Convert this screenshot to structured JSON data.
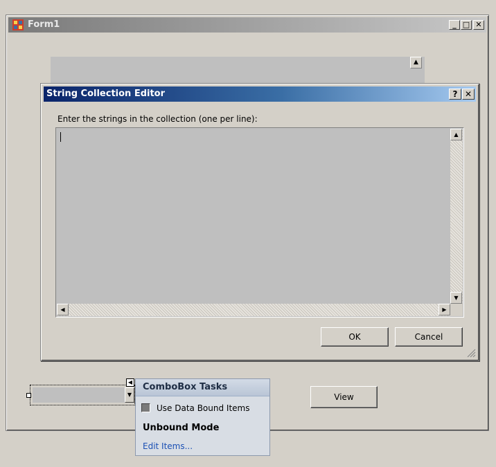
{
  "window": {
    "title": "Form1",
    "minimize_label": "_",
    "maximize_label": "□",
    "close_label": "✕"
  },
  "dialog": {
    "title": "String Collection Editor",
    "help_label": "?",
    "close_label": "✕",
    "instruction": "Enter the strings in the collection (one per line):",
    "text_value": "",
    "ok_label": "OK",
    "cancel_label": "Cancel"
  },
  "combobox": {
    "value": "",
    "smart_tag_icon": "left-arrow-icon",
    "tasks_title": "ComboBox Tasks",
    "use_data_bound_label": "Use Data Bound Items",
    "use_data_bound_checked": false,
    "mode_label": "Unbound Mode",
    "edit_items_label": "Edit Items..."
  },
  "view_button_label": "View",
  "colors": {
    "dialog_title_start": "#0a246a",
    "dialog_title_end": "#a6caf0",
    "form_bg": "#d4d0c8",
    "tasks_bg": "#d8dde4",
    "link": "#1a4fb4"
  }
}
